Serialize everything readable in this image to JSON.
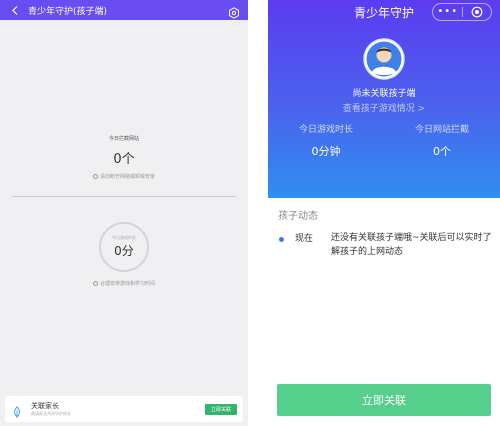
{
  "left_screen": {
    "header": {
      "title": "青少年守护(孩子端)",
      "back_icon": "chevron-left-icon",
      "settings_icon": "gear-icon"
    },
    "blocked_sites": {
      "label": "今日拦截网站",
      "value": "0个",
      "hint": "请勿断开网络或卸载管家"
    },
    "game_time": {
      "label": "今日游戏时长",
      "value": "0分",
      "hint": "合理安排游戏和学习时间"
    },
    "footer": {
      "title": "关联家长",
      "subtitle": "邀请家长共同守护成长",
      "button_label": "立即关联"
    }
  },
  "right_screen": {
    "header": {
      "title": "青少年守护",
      "menu_dots": "•••"
    },
    "status_text": "尚未关联孩子端",
    "view_link": "查看孩子游戏情况 >",
    "stats": [
      {
        "label": "今日游戏时长",
        "value": "0分钟"
      },
      {
        "label": "今日网站拦截",
        "value": "0个"
      }
    ],
    "activity": {
      "section_title": "孩子动态",
      "items": [
        {
          "time": "现在",
          "text": "还没有关联孩子端哦~关联后可以实时了解孩子的上网动态"
        }
      ]
    },
    "cta_label": "立即关联"
  },
  "colors": {
    "left_header": "#6a4df0",
    "hero_top": "#5b3cf0",
    "hero_bottom": "#2f8ff0",
    "green_button": "#33b36b",
    "cta_button": "#57cf8c",
    "activity_dot": "#3a7bef"
  }
}
